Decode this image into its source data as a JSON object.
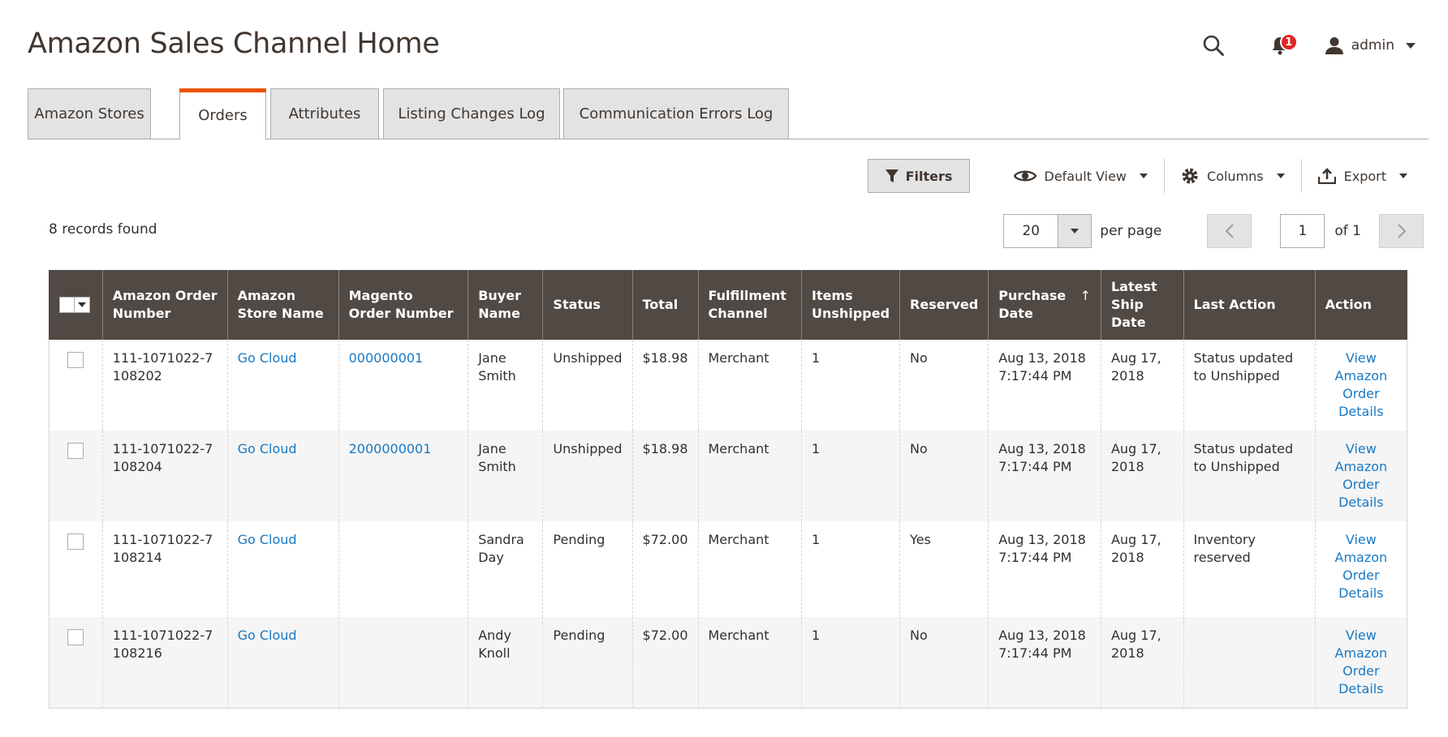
{
  "page": {
    "title": "Amazon Sales Channel Home"
  },
  "header": {
    "notification_count": "1",
    "user_name": "admin"
  },
  "tabs": [
    {
      "label": "Amazon Stores",
      "active": false
    },
    {
      "label": "Orders",
      "active": true
    },
    {
      "label": "Attributes",
      "active": false
    },
    {
      "label": "Listing Changes Log",
      "active": false
    },
    {
      "label": "Communication Errors Log",
      "active": false
    }
  ],
  "toolbar": {
    "filters_label": "Filters",
    "view_label": "Default View",
    "columns_label": "Columns",
    "export_label": "Export"
  },
  "records_found": "8 records found",
  "pager": {
    "per_page_value": "20",
    "per_page_label": "per page",
    "current_page": "1",
    "of_label": "of 1"
  },
  "grid": {
    "headers": [
      "Amazon Order Number",
      "Amazon Store Name",
      "Magento Order Number",
      "Buyer Name",
      "Status",
      "Total",
      "Fulfillment Channel",
      "Items Unshipped",
      "Reserved",
      "Purchase Date",
      "Latest Ship Date",
      "Last Action",
      "Action"
    ],
    "sort_arrow": "↑",
    "rows": [
      {
        "order_number": "111-1071022-7108202",
        "store": "Go Cloud",
        "magento_order": "000000001",
        "buyer": "Jane Smith",
        "status": "Unshipped",
        "total": "$18.98",
        "channel": "Merchant",
        "items": "1",
        "reserved": "No",
        "purchase_date": "Aug 13, 2018 7:17:44 PM",
        "ship_date": "Aug 17, 2018",
        "last_action": "Status updated to Unshipped",
        "action": "View Amazon Order Details"
      },
      {
        "order_number": "111-1071022-7108204",
        "store": "Go Cloud",
        "magento_order": "2000000001",
        "buyer": "Jane Smith",
        "status": "Unshipped",
        "total": "$18.98",
        "channel": "Merchant",
        "items": "1",
        "reserved": "No",
        "purchase_date": "Aug 13, 2018 7:17:44 PM",
        "ship_date": "Aug 17, 2018",
        "last_action": "Status updated to Unshipped",
        "action": "View Amazon Order Details"
      },
      {
        "order_number": "111-1071022-7108214",
        "store": "Go Cloud",
        "magento_order": "",
        "buyer": "Sandra Day",
        "status": "Pending",
        "total": "$72.00",
        "channel": "Merchant",
        "items": "1",
        "reserved": "Yes",
        "purchase_date": "Aug 13, 2018 7:17:44 PM",
        "ship_date": "Aug 17, 2018",
        "last_action": "Inventory reserved",
        "action": "View Amazon Order Details"
      },
      {
        "order_number": "111-1071022-7108216",
        "store": "Go Cloud",
        "magento_order": "",
        "buyer": "Andy Knoll",
        "status": "Pending",
        "total": "$72.00",
        "channel": "Merchant",
        "items": "1",
        "reserved": "No",
        "purchase_date": "Aug 13, 2018 7:17:44 PM",
        "ship_date": "Aug 17, 2018",
        "last_action": "",
        "action": "View Amazon Order Details"
      }
    ]
  },
  "colors": {
    "accent": "#eb5202",
    "header_bg": "#514943",
    "link": "#1979c3",
    "badge": "#e22626"
  }
}
